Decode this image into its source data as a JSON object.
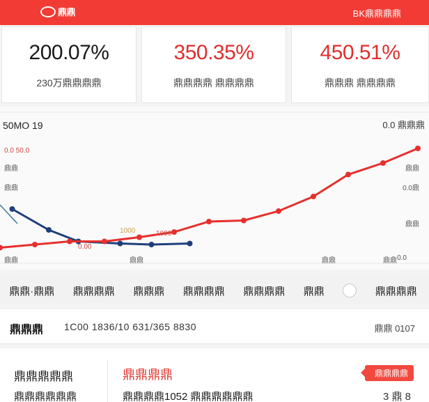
{
  "header": {
    "logo_text": "鼎鼎",
    "right_text": "BK鼎鼎鼎鼎"
  },
  "stats": [
    {
      "value": "200.07%",
      "label": "230万鼎鼎鼎鼎"
    },
    {
      "value": "350.35%",
      "label": "鼎鼎鼎鼎 鼎鼎鼎鼎"
    },
    {
      "value": "450.51%",
      "label": "鼎鼎鼎 鼎鼎鼎鼎"
    }
  ],
  "chart_data": {
    "type": "line",
    "title_left": "50MO 19",
    "title_right": "0.0 鼎鼎鼎",
    "y_tick_labels_left": [
      "0.0 50.0",
      "鼎鼎",
      "鼎鼎",
      "鼎鼎"
    ],
    "y_tick_labels_right": [
      "鼎鼎",
      "0.0鼎",
      "鼎鼎",
      "0.0"
    ],
    "x_tick_labels": [
      "鼎鼎",
      "鼎鼎",
      "鼎鼎"
    ],
    "annotations": [
      "1000",
      "1000",
      "0.00"
    ],
    "series": [
      {
        "name": "",
        "color": "#1f3f7a",
        "x": [
          0,
          1,
          2,
          3,
          4,
          5
        ],
        "y": [
          5.2,
          3.2,
          2.1,
          1.9,
          1.8,
          1.9
        ]
      },
      {
        "name": "",
        "color": "#e5302d",
        "x": [
          0,
          1,
          2,
          3,
          4,
          5,
          6,
          7,
          8,
          9,
          10,
          11,
          12
        ],
        "y": [
          1.5,
          1.8,
          2.1,
          2.1,
          2.5,
          3.0,
          4.0,
          4.1,
          5.0,
          6.4,
          8.5,
          9.6,
          11.0
        ]
      },
      {
        "name": "",
        "color": "#3b7a9b",
        "x": [
          0,
          1
        ],
        "y": [
          5.6,
          3.8
        ]
      }
    ],
    "xlim": [
      0,
      12
    ],
    "ylim": [
      0,
      13
    ]
  },
  "tabs": [
    "鼎鼎·鼎鼎",
    "鼎鼎鼎鼎",
    "鼎鼎鼎",
    "鼎鼎鼎鼎",
    "鼎鼎鼎鼎",
    "鼎鼎",
    "鼎鼎鼎鼎"
  ],
  "info": {
    "label": "鼎鼎鼎",
    "value": "1C00 1836/10 631/365 8830",
    "right": "鼎鼎 0107"
  },
  "bottom": {
    "left_line_1": "鼎鼎鼎鼎鼎",
    "left_line_2": "鼎鼎鼎鼎鼎鼎",
    "title": "鼎鼎鼎鼎",
    "desc": "鼎鼎鼎鼎1052 鼎鼎鼎鼎鼎鼎",
    "tag": "鼎鼎鼎鼎",
    "right": "3 鼎 8"
  }
}
